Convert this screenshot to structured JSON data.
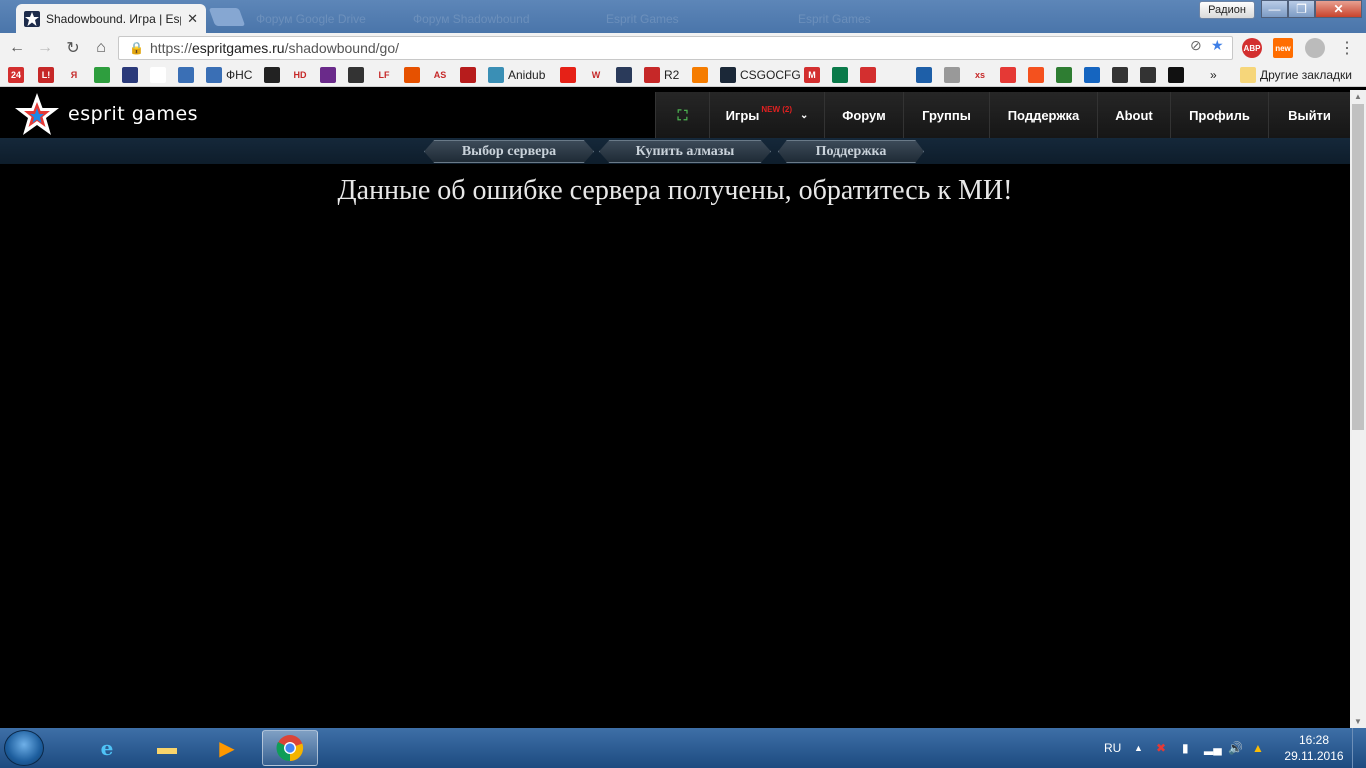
{
  "browser": {
    "tabs": [
      {
        "title": "Shadowbound. Игра | Espr",
        "active": true
      },
      {
        "title": "Форум Google Drive",
        "active": false
      },
      {
        "title": "Форум Shadowbound",
        "active": false
      },
      {
        "title": "Esprit Games",
        "active": false
      },
      {
        "title": "Esprit Games",
        "active": false
      }
    ],
    "user_badge": "Радион",
    "window_min": "—",
    "window_max": "❐",
    "window_close": "✕",
    "url_scheme": "https://",
    "url_host": "espritgames.ru",
    "url_path": "/shadowbound/go/",
    "ext_abp": "ABP",
    "ext_new": "new",
    "bookmarks": [
      {
        "label": "24",
        "icon_color": "#d32f2f",
        "text": ""
      },
      {
        "label": "L!",
        "icon_color": "#c62828",
        "text": ""
      },
      {
        "label": "Я",
        "icon_color": "#f2f2f2",
        "text": ""
      },
      {
        "label": "",
        "icon_color": "#2e9e3e",
        "text": ""
      },
      {
        "label": "",
        "icon_color": "#2b3a7a",
        "text": ""
      },
      {
        "label": "",
        "icon_color": "#ffffff",
        "text": ""
      },
      {
        "label": "",
        "icon_color": "#3a6fb5",
        "text": ""
      },
      {
        "label": "",
        "icon_color": "#3a6fb5",
        "text": "ФНС"
      },
      {
        "label": "",
        "icon_color": "#222222",
        "text": ""
      },
      {
        "label": "HD",
        "icon_color": "#f2f2f2",
        "text": ""
      },
      {
        "label": "",
        "icon_color": "#6a2a8a",
        "text": ""
      },
      {
        "label": "",
        "icon_color": "#333333",
        "text": ""
      },
      {
        "label": "LF",
        "icon_color": "#f2f2f2",
        "text": ""
      },
      {
        "label": "",
        "icon_color": "#e65100",
        "text": ""
      },
      {
        "label": "AS",
        "icon_color": "#f2f2f2",
        "text": ""
      },
      {
        "label": "",
        "icon_color": "#b71c1c",
        "text": ""
      },
      {
        "label": "",
        "icon_color": "#3a8fb5",
        "text": "Anidub"
      },
      {
        "label": "",
        "icon_color": "#e62117",
        "text": ""
      },
      {
        "label": "W",
        "icon_color": "#f2f2f2",
        "text": ""
      },
      {
        "label": "",
        "icon_color": "#2a3a5a",
        "text": ""
      },
      {
        "label": "",
        "icon_color": "#c62828",
        "text": "R2"
      },
      {
        "label": "",
        "icon_color": "#f57c00",
        "text": ""
      },
      {
        "label": "",
        "icon_color": "#1b2838",
        "text": "CSGOCFG"
      },
      {
        "label": "M",
        "icon_color": "#d32f2f",
        "text": ""
      },
      {
        "label": "",
        "icon_color": "#0a7a4a",
        "text": ""
      },
      {
        "label": "",
        "icon_color": "#d32f2f",
        "text": ""
      },
      {
        "label": "",
        "icon_color": "#f2f2f2",
        "text": ""
      },
      {
        "label": "",
        "icon_color": "#1e5fa8",
        "text": ""
      },
      {
        "label": "",
        "icon_color": "#999999",
        "text": ""
      },
      {
        "label": "xs",
        "icon_color": "#f2f2f2",
        "text": ""
      },
      {
        "label": "",
        "icon_color": "#e53935",
        "text": ""
      },
      {
        "label": "",
        "icon_color": "#f4511e",
        "text": ""
      },
      {
        "label": "",
        "icon_color": "#2e7d32",
        "text": ""
      },
      {
        "label": "",
        "icon_color": "#1565c0",
        "text": ""
      },
      {
        "label": "",
        "icon_color": "#333333",
        "text": ""
      },
      {
        "label": "",
        "icon_color": "#333333",
        "text": ""
      },
      {
        "label": "",
        "icon_color": "#111111",
        "text": ""
      }
    ],
    "bookmarks_more": "»",
    "other_bookmarks": "Другие закладки"
  },
  "site": {
    "logo_text": "esprit games",
    "nav": [
      {
        "label": "",
        "icon": "fullscreen-icon"
      },
      {
        "label": "Игры",
        "badge": "NEW (2)"
      },
      {
        "label": "Форум"
      },
      {
        "label": "Группы"
      },
      {
        "label": "Поддержка"
      },
      {
        "label": "About"
      },
      {
        "label": "Профиль"
      },
      {
        "label": "Выйти"
      }
    ],
    "subnav": [
      {
        "label": "Выбор сервера"
      },
      {
        "label": "Купить алмазы"
      },
      {
        "label": "Поддержка"
      }
    ],
    "error_message": "Данные об ошибке сервера получены, обратитесь к МИ!"
  },
  "taskbar": {
    "language": "RU",
    "time": "16:28",
    "date": "29.11.2016"
  },
  "colors": {
    "page_bg": "#000000",
    "accent_red": "#e02020",
    "subnav_bg": "#15283a"
  }
}
